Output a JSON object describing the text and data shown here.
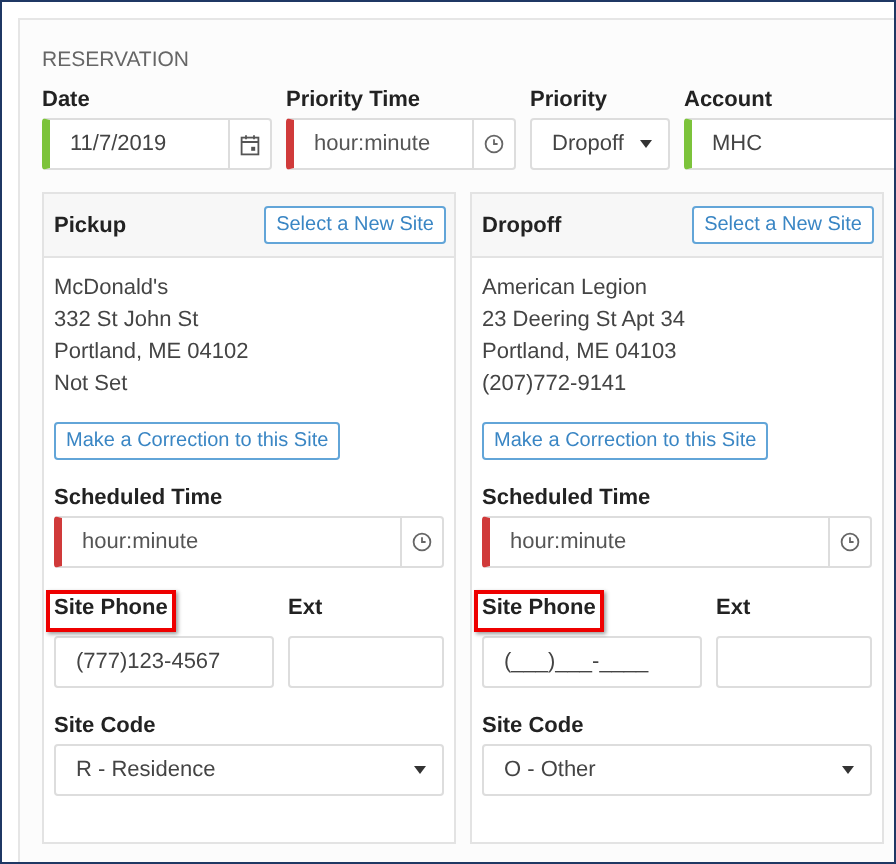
{
  "section_title": "RESERVATION",
  "fields": [
    {
      "kind": "date",
      "label": "Date",
      "value": "11/7/2019",
      "valid": true
    },
    {
      "kind": "time",
      "label": "Priority Time",
      "placeholder": "hour:minute",
      "valid": false
    },
    {
      "kind": "select",
      "label": "Priority",
      "value": "Dropoff"
    },
    {
      "kind": "text",
      "label": "Account",
      "value": "MHC",
      "valid": true
    }
  ],
  "sites": [
    {
      "title": "Pickup",
      "select_button": "Select a New Site",
      "address_lines": [
        "McDonald's",
        "332 St John St",
        "Portland, ME 04102",
        "Not Set"
      ],
      "correction_button": "Make a Correction to this Site",
      "scheduled_time": {
        "label": "Scheduled Time",
        "placeholder": "hour:minute",
        "valid": false
      },
      "phone": {
        "label": "Site Phone",
        "highlighted": true,
        "value": "(777)123-4567"
      },
      "ext": {
        "label": "Ext"
      },
      "site_code": {
        "label": "Site Code",
        "value": "R - Residence"
      }
    },
    {
      "title": "Dropoff",
      "select_button": "Select a New Site",
      "address_lines": [
        "American Legion",
        "23 Deering St Apt 34",
        "Portland, ME 04103",
        "(207)772-9141"
      ],
      "correction_button": "Make a Correction to this Site",
      "scheduled_time": {
        "label": "Scheduled Time",
        "placeholder": "hour:minute",
        "valid": false
      },
      "phone": {
        "label": "Site Phone",
        "highlighted": true,
        "value": "(___)___-____"
      },
      "ext": {
        "label": "Ext"
      },
      "site_code": {
        "label": "Site Code",
        "value": "O - Other"
      }
    }
  ]
}
